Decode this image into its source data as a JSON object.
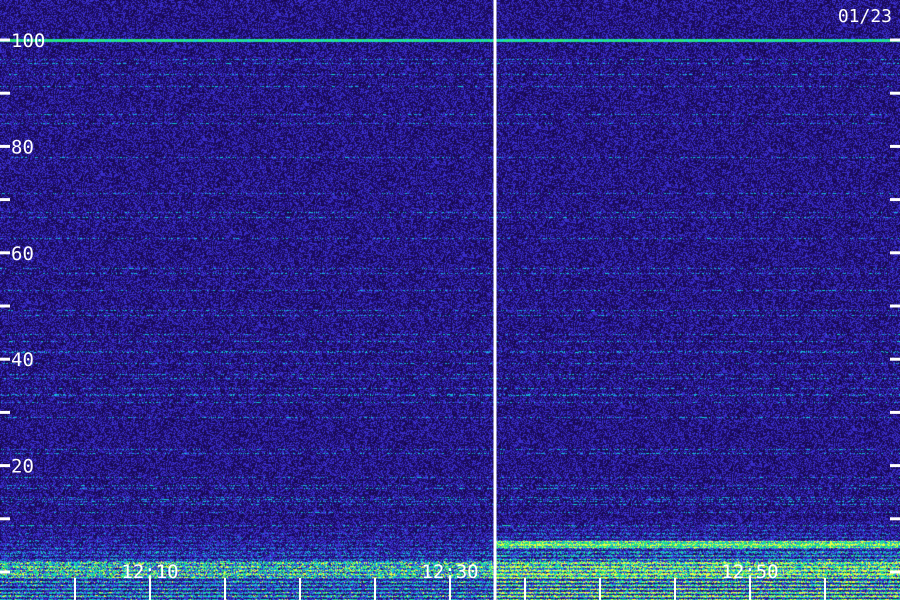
{
  "chart_data": {
    "type": "heatmap",
    "title": "",
    "xlabel": "",
    "ylabel": "",
    "date_label": "01/23",
    "ylim": [
      0,
      100
    ],
    "y_ticks": [
      0,
      10,
      20,
      30,
      40,
      50,
      60,
      70,
      80,
      90,
      100
    ],
    "y_tick_labels": [
      {
        "value": 20,
        "text": "20"
      },
      {
        "value": 40,
        "text": "40"
      },
      {
        "value": 60,
        "text": "60"
      },
      {
        "value": 80,
        "text": "80"
      },
      {
        "value": 100,
        "text": "100"
      }
    ],
    "x_range_min": [
      0,
      60
    ],
    "x_ticks_min": [
      5,
      10,
      15,
      20,
      25,
      30,
      35,
      40,
      45,
      50,
      55
    ],
    "x_tick_labels": [
      {
        "value": 10,
        "text": "12:10"
      },
      {
        "value": 30,
        "text": "12:30"
      },
      {
        "value": 50,
        "text": "12:50"
      }
    ],
    "marker_min": 33,
    "colors": {
      "background": "#1a0a52",
      "noise": "#3a28c8",
      "band": "#22d8e6",
      "strong": "#ffff40",
      "axis": "#ffffff"
    }
  }
}
